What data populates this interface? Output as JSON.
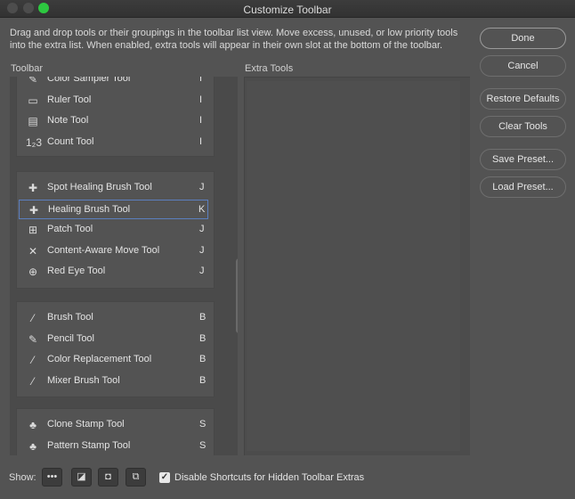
{
  "window": {
    "title": "Customize Toolbar"
  },
  "description": "Drag and drop tools or their groupings in the toolbar list view. Move excess, unused, or low priority tools into the extra list. When enabled, extra tools will appear in their own slot at the bottom of the toolbar.",
  "labels": {
    "toolbar": "Toolbar",
    "extra_tools": "Extra Tools"
  },
  "groups": [
    {
      "tools": [
        {
          "name": "Color Sampler Tool",
          "key": "I",
          "icon": "color-sampler-icon",
          "glyph": "✎"
        },
        {
          "name": "Ruler Tool",
          "key": "I",
          "icon": "ruler-icon",
          "glyph": "▭"
        },
        {
          "name": "Note Tool",
          "key": "I",
          "icon": "note-icon",
          "glyph": "▤"
        },
        {
          "name": "Count Tool",
          "key": "I",
          "icon": "count-icon",
          "glyph": "1₂3"
        }
      ]
    },
    {
      "tools": [
        {
          "name": "Spot Healing Brush Tool",
          "key": "J",
          "icon": "spot-healing-brush-icon",
          "glyph": "✚"
        },
        {
          "name": "Healing Brush Tool",
          "key": "K",
          "icon": "healing-brush-icon",
          "glyph": "✚",
          "selected": true
        },
        {
          "name": "Patch Tool",
          "key": "J",
          "icon": "patch-icon",
          "glyph": "⊞"
        },
        {
          "name": "Content-Aware Move Tool",
          "key": "J",
          "icon": "content-aware-move-icon",
          "glyph": "✕"
        },
        {
          "name": "Red Eye Tool",
          "key": "J",
          "icon": "red-eye-icon",
          "glyph": "⊕"
        }
      ]
    },
    {
      "tools": [
        {
          "name": "Brush Tool",
          "key": "B",
          "icon": "brush-icon",
          "glyph": "⁄"
        },
        {
          "name": "Pencil Tool",
          "key": "B",
          "icon": "pencil-icon",
          "glyph": "✎"
        },
        {
          "name": "Color Replacement Tool",
          "key": "B",
          "icon": "color-replacement-icon",
          "glyph": "⁄"
        },
        {
          "name": "Mixer Brush Tool",
          "key": "B",
          "icon": "mixer-brush-icon",
          "glyph": "⁄"
        }
      ]
    },
    {
      "tools": [
        {
          "name": "Clone Stamp Tool",
          "key": "S",
          "icon": "clone-stamp-icon",
          "glyph": "♣"
        },
        {
          "name": "Pattern Stamp Tool",
          "key": "S",
          "icon": "pattern-stamp-icon",
          "glyph": "♣"
        }
      ]
    }
  ],
  "buttons": {
    "done": "Done",
    "cancel": "Cancel",
    "restore_defaults": "Restore Defaults",
    "clear_tools": "Clear Tools",
    "save_preset": "Save Preset...",
    "load_preset": "Load Preset..."
  },
  "footer": {
    "show_label": "Show:",
    "show_buttons": [
      {
        "icon": "more-dots-icon",
        "glyph": "•••"
      },
      {
        "icon": "foreground-background-icon",
        "glyph": "◪"
      },
      {
        "icon": "quick-mask-icon",
        "glyph": "◘"
      },
      {
        "icon": "screen-mode-icon",
        "glyph": "⧉"
      }
    ],
    "checkbox_label": "Disable Shortcuts for Hidden Toolbar Extras",
    "checkbox_checked": true
  }
}
